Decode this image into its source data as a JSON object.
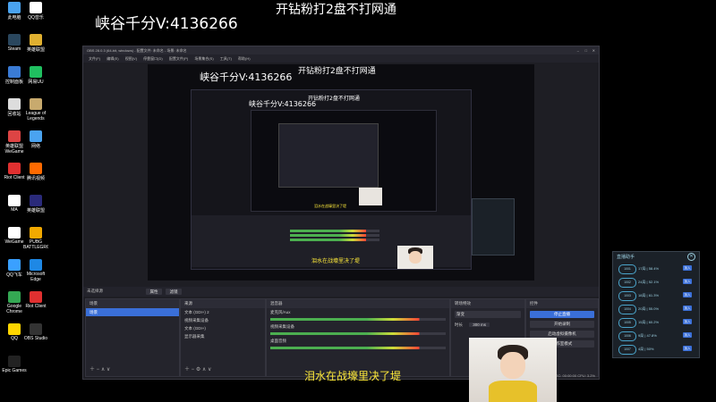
{
  "overlay": {
    "top_left_text": "峡谷千分V:4136266",
    "top_center_text": "开钻粉打2盘不打网通",
    "subtitle": "泪水在战壕里决了堤"
  },
  "nested": {
    "level1_left": "峡谷千分V:4136266",
    "level1_center": "开钻粉打2盘不打网通",
    "level1_subtitle": "泪水在战壕里决了堤",
    "level2_left": "峡谷千分V:4136266",
    "level2_center": "开钻粉打2盘不打网通",
    "level2_subtitle": "泪水在战壕里决了堤"
  },
  "desktop_icons": [
    {
      "label": "此电脑",
      "color": "#4aa3f0"
    },
    {
      "label": "QQ音乐",
      "color": "#ffffff"
    },
    {
      "label": "Steam",
      "color": "#2a475e"
    },
    {
      "label": "英雄联盟",
      "color": "#e0b030"
    },
    {
      "label": "控制面板",
      "color": "#3a7bd5"
    },
    {
      "label": "网易UU",
      "color": "#20c060"
    },
    {
      "label": "回收站",
      "color": "#dddddd"
    },
    {
      "label": "League of Legends",
      "color": "#c8aa6e"
    },
    {
      "label": "英雄联盟WeGame",
      "color": "#d44"
    },
    {
      "label": "网络",
      "color": "#4aa3f0"
    },
    {
      "label": "Riot Client",
      "color": "#e03030"
    },
    {
      "label": "腾讯视频",
      "color": "#ff6a00"
    },
    {
      "label": "MA",
      "color": "#ffffff"
    },
    {
      "label": "英雄联盟",
      "color": "#2a2a7a"
    },
    {
      "label": "WeGame",
      "color": "#ffffff"
    },
    {
      "label": "PUBG BATTLEGROUNDS",
      "color": "#f2a900"
    },
    {
      "label": "QQ飞车",
      "color": "#3aa0ff"
    },
    {
      "label": "Microsoft Edge",
      "color": "#1e88e5"
    },
    {
      "label": "Google Chrome",
      "color": "#34a853"
    },
    {
      "label": "Riot Client",
      "color": "#e03030"
    },
    {
      "label": "QQ",
      "color": "#ffd600"
    },
    {
      "label": "OBS Studio",
      "color": "#333333"
    },
    {
      "label": "Epic Games",
      "color": "#222222"
    }
  ],
  "obs": {
    "title": "OBS 28.0.3 (64-bit, windows) - 配置文件: 未命名 - 场景: 未命名",
    "menu": [
      "文件(F)",
      "编辑(E)",
      "视图(V)",
      "停靠窗口(D)",
      "配置文件(P)",
      "场景集合(S)",
      "工具(T)",
      "帮助(H)"
    ],
    "source_bar": "未选择源",
    "source_bar_props": "属性",
    "source_bar_filters": "滤镜",
    "docks": {
      "scenes": {
        "title": "场景",
        "items": [
          "场景"
        ]
      },
      "sources": {
        "title": "来源",
        "items": [
          "文本 (GDI+) 2",
          "视频采集设备",
          "文本 (GDI+)",
          "显示器采集"
        ]
      },
      "mixer": {
        "title": "混音器",
        "channels": [
          {
            "name": "麦克风/Aux",
            "db": "0.0 dB"
          },
          {
            "name": "视频采集设备",
            "db": "-3.2 dB"
          },
          {
            "name": "桌面音频",
            "db": "0.0 dB"
          }
        ]
      },
      "transitions": {
        "title": "转场特效",
        "type": "渐变",
        "duration_label": "时长",
        "duration": "300 ms"
      },
      "controls": {
        "title": "控件",
        "buttons": [
          "停止直播",
          "开始录制",
          "启动虚拟摄像机",
          "工作室模式",
          "设置",
          "退出"
        ]
      }
    },
    "status": "LIVE: 00:00:00  REC: 00:00:00  CPU: 3.2%"
  },
  "side_panel": {
    "title": "直播助手",
    "rows": [
      {
        "id": "1001",
        "info": "17局 | 58.4%",
        "action": "加入"
      },
      {
        "id": "1002",
        "info": "24局 | 52.1%",
        "action": "加入"
      },
      {
        "id": "1003",
        "info": "18局 | 61.3%",
        "action": "加入"
      },
      {
        "id": "1004",
        "info": "20局 | 55.0%",
        "action": "加入"
      },
      {
        "id": "1005",
        "info": "15局 | 60.2%",
        "action": "加入"
      },
      {
        "id": "1006",
        "info": "9局 | 47.8%",
        "action": "加入"
      },
      {
        "id": "1007",
        "info": "4局 | 50%",
        "action": "加入"
      }
    ]
  },
  "colors": {
    "accent": "#3a6fd8",
    "overlay_text": "#ffffff",
    "subtitle": "#ffeb3b",
    "side_border": "#4aa3c9"
  }
}
